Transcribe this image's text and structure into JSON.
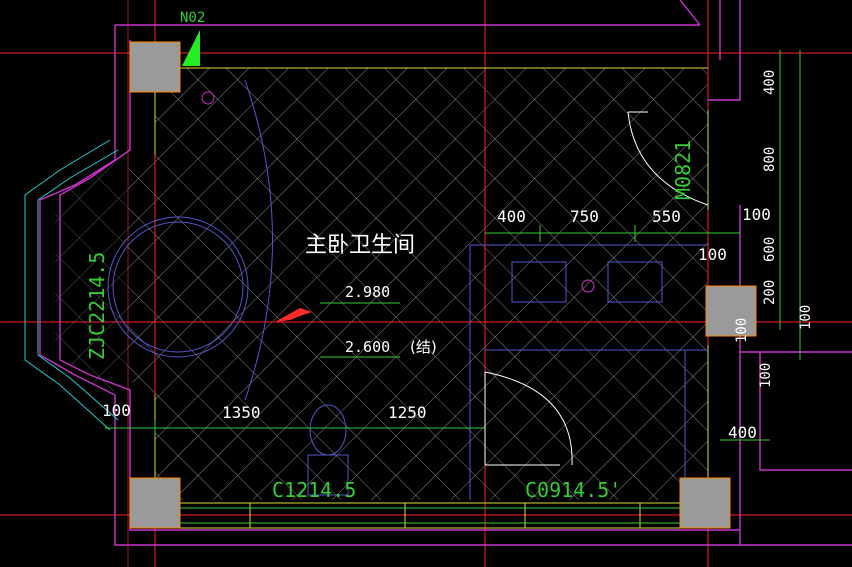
{
  "drawing": {
    "room_name": "主卧卫生间",
    "level_1": "2.980",
    "level_2": "2.600",
    "level_2_note": "(结)",
    "axis_tag": "N02",
    "door_top_right": "M0821",
    "door_bottom": "C0914.5'",
    "window_bottom_left": "C1214.5",
    "window_left_bay": "ZJC2214.5",
    "dims_top_row": [
      "400",
      "750",
      "550"
    ],
    "dim_right_100": "100",
    "dims_bottom_row": [
      "1350",
      "1250"
    ],
    "dim_left_100": "100",
    "dims_right_vertical": [
      "400",
      "800",
      "100",
      "600",
      "200",
      "100",
      "100"
    ],
    "dim_right_100_b": "100",
    "dim_bottom_right_400": "400",
    "dim_right_100_c": "100"
  },
  "colors": {
    "background": "#000000",
    "wall_outline": "#cc33cc",
    "grid_red": "#ff2020",
    "dimension_green": "#33cc33",
    "hatch": "#b0b0b0",
    "column_fill": "#9a9a9a",
    "text_white": "#ffffff",
    "text_green": "#33cc33",
    "wall_yellow": "#dddd33",
    "arrow_red": "#ff2a2a"
  }
}
